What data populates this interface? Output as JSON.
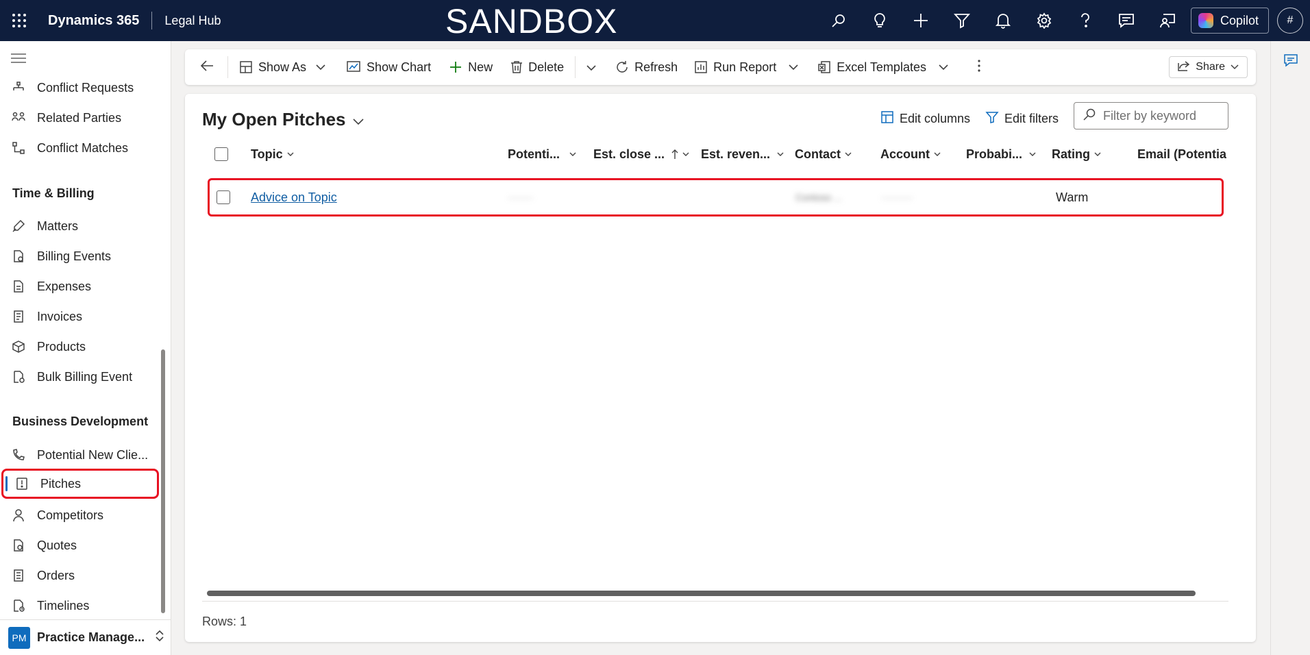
{
  "topbar": {
    "app_name": "Dynamics 365",
    "app_sub": "Legal Hub",
    "environment_banner": "SANDBOX",
    "copilot_label": "Copilot",
    "account_label": "#"
  },
  "sidebar": {
    "items_top": [
      {
        "label": "Conflict Requests",
        "icon": "conflict-requests-icon"
      },
      {
        "label": "Related Parties",
        "icon": "related-parties-icon"
      },
      {
        "label": "Conflict Matches",
        "icon": "conflict-matches-icon"
      }
    ],
    "group_time_billing": "Time & Billing",
    "items_billing": [
      {
        "label": "Matters",
        "icon": "matters-icon"
      },
      {
        "label": "Billing Events",
        "icon": "billing-events-icon"
      },
      {
        "label": "Expenses",
        "icon": "expenses-icon"
      },
      {
        "label": "Invoices",
        "icon": "invoices-icon"
      },
      {
        "label": "Products",
        "icon": "products-icon"
      },
      {
        "label": "Bulk Billing Event",
        "icon": "bulk-billing-icon"
      }
    ],
    "group_business_dev": "Business Development",
    "items_bizdev": [
      {
        "label": "Potential New Clie...",
        "icon": "potential-clients-icon"
      },
      {
        "label": "Pitches",
        "icon": "pitches-icon"
      },
      {
        "label": "Competitors",
        "icon": "competitors-icon"
      },
      {
        "label": "Quotes",
        "icon": "quotes-icon"
      },
      {
        "label": "Orders",
        "icon": "orders-icon"
      },
      {
        "label": "Timelines",
        "icon": "timelines-icon"
      }
    ],
    "area": {
      "badge": "PM",
      "label": "Practice Manage..."
    }
  },
  "cmdbar": {
    "show_as": "Show As",
    "show_chart": "Show Chart",
    "new": "New",
    "delete": "Delete",
    "refresh": "Refresh",
    "run_report": "Run Report",
    "excel_templates": "Excel Templates",
    "share": "Share"
  },
  "view": {
    "title": "My Open Pitches",
    "edit_columns": "Edit columns",
    "edit_filters": "Edit filters",
    "filter_placeholder": "Filter by keyword",
    "columns": [
      "Topic",
      "Potenti...",
      "Est. close ...",
      "Est. reven...",
      "Contact",
      "Account",
      "Probabi...",
      "Rating",
      "Email (Potential..."
    ],
    "rows": [
      {
        "topic": "Advice on Topic",
        "potential": "········",
        "est_close": "",
        "est_revenue": "",
        "contact": "Contoso ...",
        "account": "··········",
        "probability": "",
        "rating": "Warm",
        "email": ""
      }
    ],
    "rows_count": "Rows: 1"
  },
  "colors": {
    "topbar_bg": "#0f1e3d",
    "accent": "#0f6cbd",
    "highlight": "#e81123"
  }
}
